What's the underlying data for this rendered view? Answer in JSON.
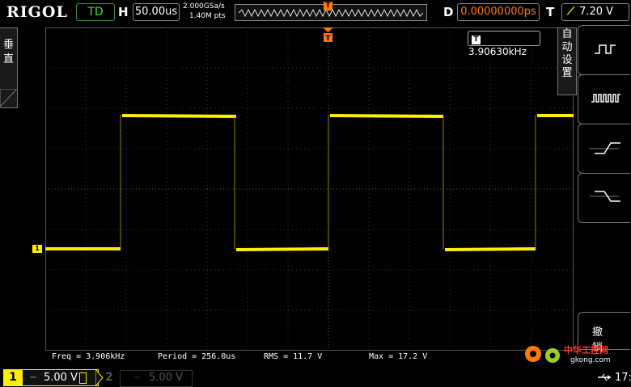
{
  "brand": "RIGOL",
  "top_bar": {
    "run_state": "TD",
    "h_label": "H",
    "timebase": "50.00us",
    "sample_rate": "2.000GSa/s",
    "memory_depth": "1.40M pts",
    "trigger_marker": "T",
    "d_label": "D",
    "trigger_delay": "0.00000000ps",
    "t_label": "T",
    "trigger_level": "7.20 V"
  },
  "left_menu": {
    "tab_chars": [
      "垂",
      "直"
    ]
  },
  "right_menu": {
    "auto_chars": [
      "自",
      "动",
      "设",
      "置"
    ],
    "undo_label": "撤销"
  },
  "freq_badge": {
    "icon": "T",
    "value": "3.90630kHz"
  },
  "channel_marker": "1",
  "measurements": {
    "freq": "Freq = 3.906kHz",
    "period": "Period = 256.0us",
    "rms": "RMS = 11.7 V",
    "max": "Max = 17.2 V"
  },
  "bottom_bar": {
    "ch1_number": "1",
    "ch1_coupling": "⎓",
    "ch1_scale": "5.00 V",
    "ch2_number": "2",
    "ch2_coupling": "⎓",
    "ch2_scale": "5.00 V",
    "clock": "17:"
  },
  "watermark": {
    "line1": "中华工控网",
    "line2": "gkong.com"
  },
  "colors": {
    "ch1": "#ffee00",
    "trigger": "#ff7a00",
    "run_state": "#3fdc3f"
  },
  "icons": [
    "square-wave-pulse-icon",
    "square-wave-multi-icon",
    "rising-edge-icon",
    "falling-edge-icon",
    "usb-icon",
    "gear-icon"
  ]
}
